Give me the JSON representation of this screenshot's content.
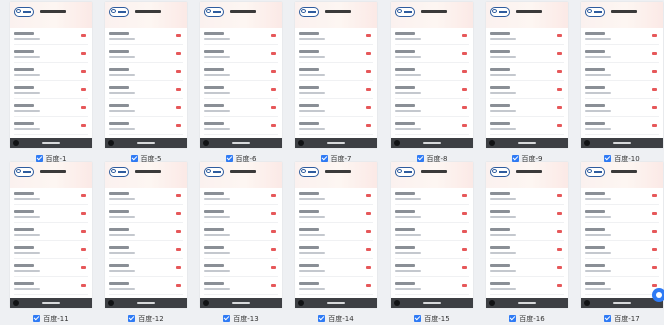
{
  "card": {
    "title": "",
    "footer_button": "",
    "records": [
      {
        "name": "",
        "time": "",
        "amount": ""
      },
      {
        "name": "",
        "time": "",
        "amount": ""
      },
      {
        "name": "",
        "time": "",
        "amount": ""
      },
      {
        "name": "",
        "time": "",
        "amount": ""
      },
      {
        "name": "",
        "time": "",
        "amount": ""
      },
      {
        "name": "",
        "time": "",
        "amount": ""
      }
    ]
  },
  "items": [
    {
      "label": "百度-1"
    },
    {
      "label": "百度-5"
    },
    {
      "label": "百度-6"
    },
    {
      "label": "百度-7"
    },
    {
      "label": "百度-8"
    },
    {
      "label": "百度-9"
    },
    {
      "label": "百度-10"
    },
    {
      "label": "百度-11"
    },
    {
      "label": "百度-12"
    },
    {
      "label": "百度-13"
    },
    {
      "label": "百度-14"
    },
    {
      "label": "百度-15"
    },
    {
      "label": "百度-16"
    },
    {
      "label": "百度-17"
    }
  ],
  "colors": {
    "accent": "#2f7bf5",
    "amount": "#e6585a",
    "footer_bar": "#3d3f43"
  },
  "icons": {
    "checkbox": "checkbox-checked-icon",
    "logo": "brand-logo-icon",
    "footer": "circle-icon",
    "help": "help-float-icon"
  }
}
